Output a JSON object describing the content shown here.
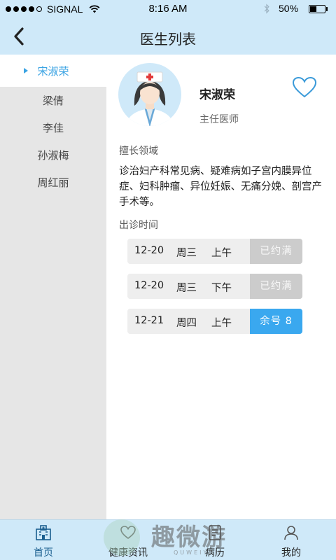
{
  "status_bar": {
    "carrier": "SIGNAL",
    "time": "8:16 AM",
    "battery": "50%",
    "battery_level": 0.5
  },
  "nav": {
    "title": "医生列表"
  },
  "doctors": [
    {
      "name": "宋淑荣",
      "active": true
    },
    {
      "name": "梁倩",
      "active": false
    },
    {
      "name": "李佳",
      "active": false
    },
    {
      "name": "孙淑梅",
      "active": false
    },
    {
      "name": "周红丽",
      "active": false
    }
  ],
  "detail": {
    "name": "宋淑荣",
    "title": "主任医师",
    "expertise_label": "擅长领域",
    "expertise": "诊治妇产科常见病、疑难病如子宫内膜异位症、妇科肿瘤、异位妊娠、无痛分娩、剖宫产手术等。",
    "schedule_label": "出诊时间",
    "slots": [
      {
        "date": "12-20",
        "day": "周三",
        "period": "上午",
        "status": "已约满",
        "available": false
      },
      {
        "date": "12-20",
        "day": "周三",
        "period": "下午",
        "status": "已约满",
        "available": false
      },
      {
        "date": "12-21",
        "day": "周四",
        "period": "上午",
        "status": "余号 8",
        "available": true
      }
    ]
  },
  "tabs": [
    {
      "label": "首页",
      "icon": "hospital-icon",
      "active": true
    },
    {
      "label": "健康资讯",
      "icon": "heart-icon",
      "active": false
    },
    {
      "label": "病历",
      "icon": "record-icon",
      "active": false
    },
    {
      "label": "我的",
      "icon": "user-icon",
      "active": false
    }
  ],
  "watermark": {
    "logo_text": "趣微游",
    "sub_text": "QUWEIYOU"
  },
  "colors": {
    "accent": "#3aa8ef",
    "bar_bg": "#cfe9f9",
    "list_bg": "#e6e6e6",
    "full_slot": "#cccccc"
  }
}
